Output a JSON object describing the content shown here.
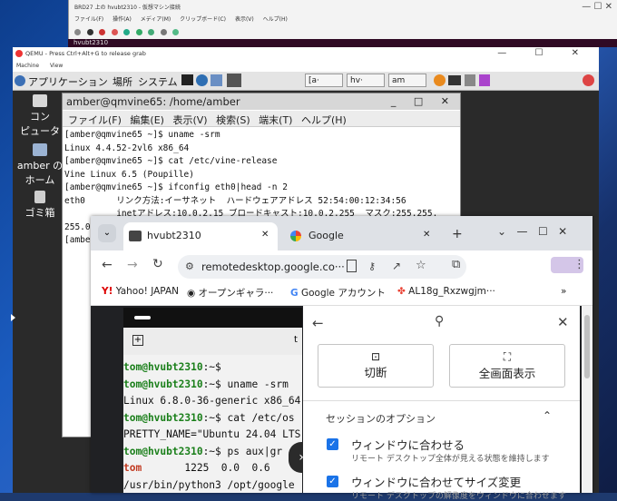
{
  "vbox": {
    "title": "BRD27 上の hvubt2310 - 仮想マシン接続",
    "menu": [
      "ファイル(F)",
      "操作(A)",
      "メディア(M)",
      "クリップボード(C)",
      "表示(V)",
      "ヘルプ(H)"
    ],
    "controls": "—  ☐  ✕",
    "guest_label": "hvubt2310"
  },
  "qemu": {
    "title": "QEMU - Press Ctrl+Alt+G to release grab",
    "menu": [
      "Machine",
      "View"
    ],
    "controls": "—  ☐  ✕"
  },
  "panel": {
    "applications": "アプリケーション",
    "places": "場所",
    "system": "システム",
    "tasks": [
      "[a·",
      "hv·",
      "am"
    ]
  },
  "desktop_icons": [
    {
      "label": "コン\nピュータ"
    },
    {
      "label": "amber の\nホーム"
    },
    {
      "label": "ゴミ箱"
    }
  ],
  "terminal": {
    "title": "amber@qmvine65: /home/amber",
    "controls": "_ □ ✕",
    "menu": [
      "ファイル(F)",
      "編集(E)",
      "表示(V)",
      "検索(S)",
      "端末(T)",
      "ヘルプ(H)"
    ],
    "lines": [
      "[amber@qmvine65 ~]$ uname -srm",
      "Linux 4.4.52-2vl6 x86_64",
      "[amber@qmvine65 ~]$ cat /etc/vine-release",
      "Vine Linux 6.5 (Poupille)",
      "[amber@qmvine65 ~]$ ifconfig eth0|head -n 2",
      "eth0      リンク方法:イーサネット  ハードウェアアドレス 52:54:00:12:34:56",
      "          inetアドレス:10.0.2.15 ブロードキャスト:10.0.2.255  マスク:255.255.",
      "255.0",
      "[ambe"
    ]
  },
  "chrome": {
    "tabs": [
      {
        "label": "hvubt2310",
        "close": "✕"
      },
      {
        "label": "Google",
        "close": "✕"
      }
    ],
    "new_tab": "+",
    "window_controls": "⌄   —   ☐   ✕",
    "url": "remotedesktop.google.co···",
    "bookmarks": [
      "Yahoo! JAPAN",
      "オープンギャラ···",
      "Google アカウント",
      "AL18g_Rxzwgjm···"
    ],
    "more": "»"
  },
  "remote_terminal": {
    "tab_label": "t",
    "lines": [
      {
        "prompt": "tom@hvubt2310",
        "rest": ":~$"
      },
      {
        "prompt": "tom@hvubt2310",
        "rest": ":~$ uname -srm"
      },
      {
        "plain": "Linux 6.8.0-36-generic x86_64"
      },
      {
        "prompt": "tom@hvubt2310",
        "rest": ":~$ cat /etc/os"
      },
      {
        "plain": "PRETTY_NAME=\"Ubuntu 24.04 LTS"
      },
      {
        "prompt": "tom@hvubt2310",
        "rest": ":~$ ps aux|gr"
      },
      {
        "red": "tom",
        "plain": "       1225  0.0  0.6"
      },
      {
        "plain": "/usr/bin/python3 /opt/google"
      }
    ]
  },
  "side_panel": {
    "disconnect": "切断",
    "fullscreen": "全画面表示",
    "session_options": "セッションのオプション",
    "opt1_title": "ウィンドウに合わせる",
    "opt1_desc": "リモート デスクトップ全体が見える状態を維持します",
    "opt2_title": "ウィンドウに合わせてサイズ変更",
    "opt2_desc": "リモート デスクトップの解像度をウィンドウに合わせます"
  }
}
